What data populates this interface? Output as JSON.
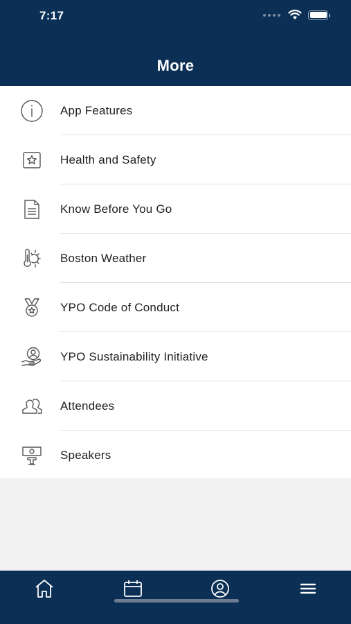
{
  "status_bar": {
    "time": "7:17"
  },
  "header": {
    "title": "More"
  },
  "menu": {
    "items": [
      {
        "label": "App Features",
        "icon": "info-icon"
      },
      {
        "label": "Health and Safety",
        "icon": "star-badge-icon"
      },
      {
        "label": "Know Before You Go",
        "icon": "document-icon"
      },
      {
        "label": "Boston Weather",
        "icon": "thermometer-sun-icon"
      },
      {
        "label": "YPO Code of Conduct",
        "icon": "medal-icon"
      },
      {
        "label": "YPO Sustainability Initiative",
        "icon": "hand-person-icon"
      },
      {
        "label": "Attendees",
        "icon": "people-icon"
      },
      {
        "label": "Speakers",
        "icon": "podium-icon"
      }
    ]
  },
  "tabbar": {
    "tabs": [
      {
        "icon": "home-icon"
      },
      {
        "icon": "calendar-icon"
      },
      {
        "icon": "profile-icon"
      },
      {
        "icon": "menu-icon"
      }
    ]
  },
  "colors": {
    "header_bg": "#0b2f55",
    "tabbar_bg": "#0b2f55",
    "background": "#f1f1f2",
    "icon_gray": "#555555"
  }
}
